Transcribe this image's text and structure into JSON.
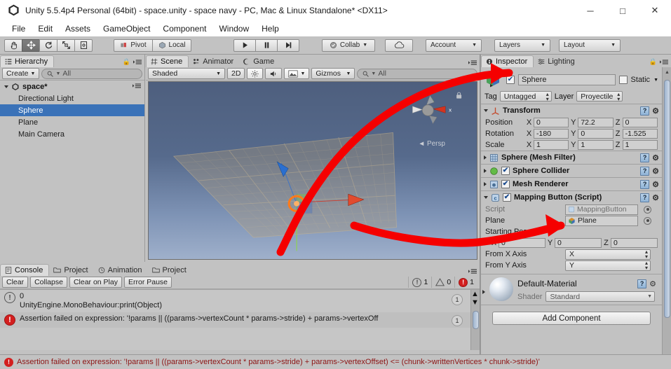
{
  "window": {
    "title": "Unity 5.5.4p4 Personal (64bit) - space.unity - space navy - PC, Mac & Linux Standalone* <DX11>",
    "minimize": "─",
    "maximize": "□",
    "close": "✕"
  },
  "menu": [
    "File",
    "Edit",
    "Assets",
    "GameObject",
    "Component",
    "Window",
    "Help"
  ],
  "toolbar": {
    "tools": [
      "hand-tool",
      "move-tool",
      "rotate-tool",
      "scale-tool",
      "rect-tool"
    ],
    "pivot": "Pivot",
    "local": "Local",
    "play": "▶",
    "pause": "❙❙",
    "step": "▶|",
    "collab": "Collab",
    "cloud": "cloud-icon",
    "account": "Account",
    "layers": "Layers",
    "layout": "Layout"
  },
  "hierarchy": {
    "tab": "Hierarchy",
    "create": "Create",
    "search_placeholder": "All",
    "scene": "space*",
    "items": [
      {
        "label": "Directional Light",
        "selected": false
      },
      {
        "label": "Sphere",
        "selected": true
      },
      {
        "label": "Plane",
        "selected": false
      },
      {
        "label": "Main Camera",
        "selected": false
      }
    ]
  },
  "scene": {
    "tabs": [
      "Scene",
      "Animator",
      "Game"
    ],
    "active_tab": "Scene",
    "shading": "Shaded",
    "mode_2d": "2D",
    "gizmos": "Gizmos",
    "search_placeholder": "All",
    "view_label": "Persp",
    "axis_label": "x"
  },
  "inspector": {
    "tabs": [
      "Inspector",
      "Lighting"
    ],
    "active_tab": "Inspector",
    "object_name": "Sphere",
    "object_enabled": "✔",
    "static_label": "Static",
    "tag_label": "Tag",
    "tag_value": "Untagged",
    "layer_label": "Layer",
    "layer_value": "Proyectile",
    "transform": {
      "title": "Transform",
      "rows": [
        {
          "label": "Position",
          "x": "0",
          "y": "72.2",
          "z": "0"
        },
        {
          "label": "Rotation",
          "x": "-180",
          "y": "0",
          "z": "-1.525"
        },
        {
          "label": "Scale",
          "x": "1",
          "y": "1",
          "z": "1"
        }
      ]
    },
    "components": [
      {
        "title": "Sphere (Mesh Filter)",
        "has_checkbox": false
      },
      {
        "title": "Sphere Collider",
        "has_checkbox": true
      },
      {
        "title": "Mesh Renderer",
        "has_checkbox": true
      },
      {
        "title": "Mapping Button (Script)",
        "has_checkbox": true
      }
    ],
    "script_rows": {
      "script_label": "Script",
      "script_value": "MappingButton",
      "plane_label": "Plane",
      "plane_value": "Plane",
      "starting_pos_label": "Starting Pos",
      "starting_pos": {
        "x": "0",
        "y": "0",
        "z": "0"
      },
      "from_x_label": "From X Axis",
      "from_x_value": "X",
      "from_y_label": "From Y Axis",
      "from_y_value": "Y"
    },
    "material": {
      "name": "Default-Material",
      "shader_label": "Shader",
      "shader_value": "Standard"
    },
    "add_component": "Add Component"
  },
  "console": {
    "tabs": [
      "Console",
      "Project",
      "Animation",
      "Project"
    ],
    "active_tab": "Console",
    "buttons": [
      "Clear",
      "Collapse",
      "Clear on Play",
      "Error Pause"
    ],
    "counts": {
      "info": "1",
      "warning": "0",
      "error": "1"
    },
    "logs": [
      {
        "type": "info",
        "line1": "0",
        "line2": "UnityEngine.MonoBehaviour:print(Object)",
        "count": "1"
      },
      {
        "type": "error",
        "line1": "Assertion failed on expression: '!params || ((params->vertexCount * params->stride) + params->vertexOff",
        "line2": "",
        "count": "1"
      }
    ]
  },
  "statusbar": {
    "message": "Assertion failed on expression: '!params || ((params->vertexCount * params->stride) + params->vertexOffset) <= (chunk->writtenVertices * chunk->stride)'"
  },
  "colors": {
    "accent_selected": "#3a72b8",
    "error_red": "#d31f1f",
    "annotation_arrow": "#f50000",
    "panel_bg": "#c2c2c2"
  }
}
